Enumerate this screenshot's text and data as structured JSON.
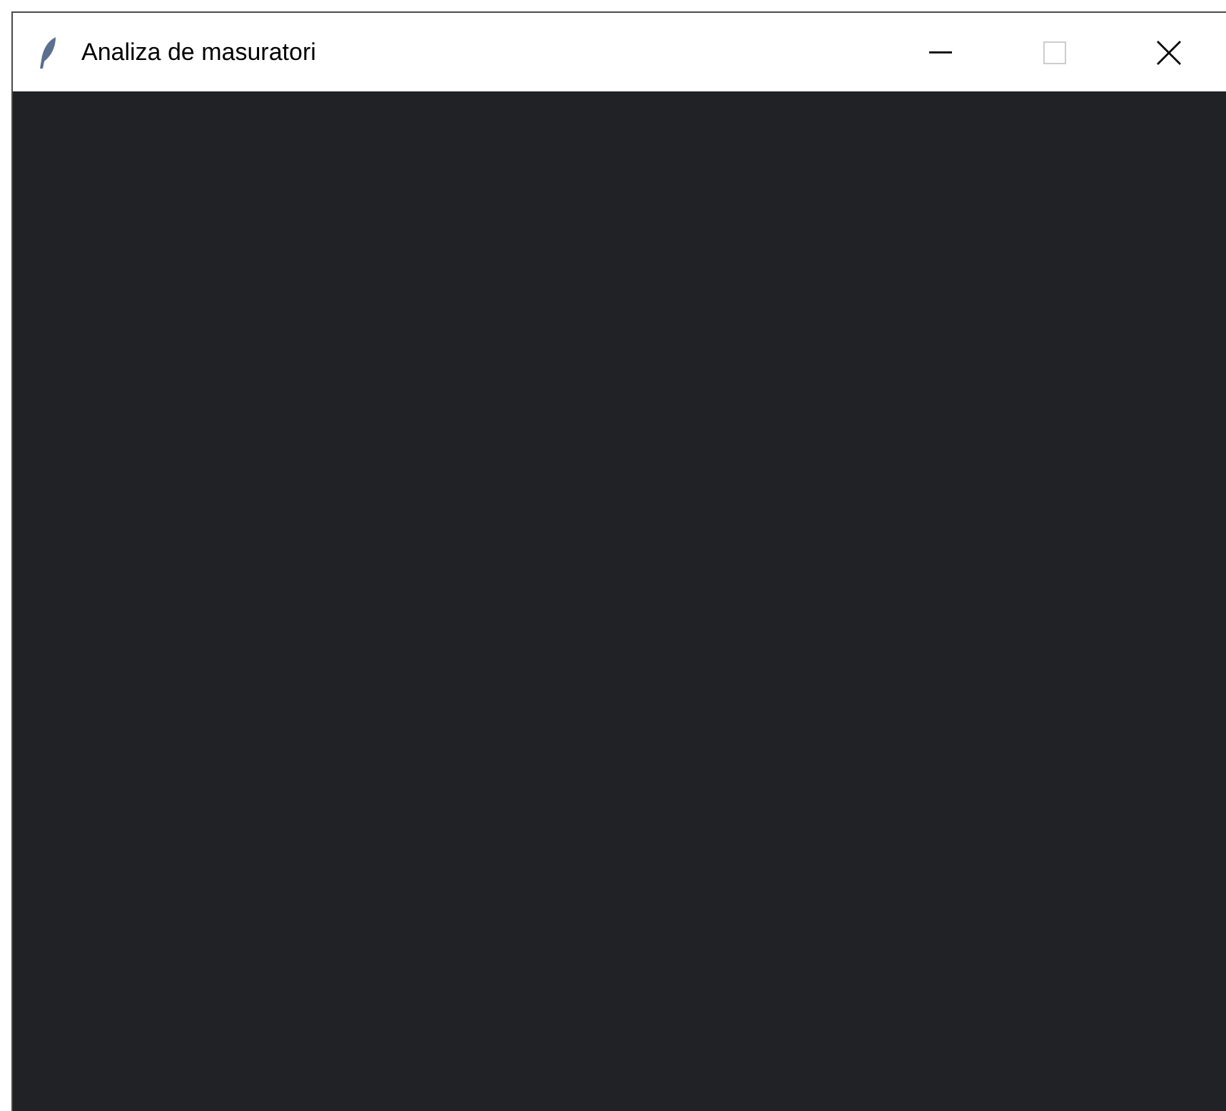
{
  "window": {
    "title": "Analiza de masuratori",
    "maximize_disabled": true
  }
}
